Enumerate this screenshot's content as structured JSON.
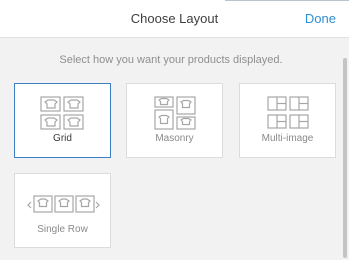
{
  "header": {
    "title": "Choose Layout",
    "done_label": "Done"
  },
  "instruction": "Select how you want your products displayed.",
  "layouts": [
    {
      "label": "Grid",
      "icon": "grid-layout-icon",
      "selected": true
    },
    {
      "label": "Masonry",
      "icon": "masonry-layout-icon",
      "selected": false
    },
    {
      "label": "Multi-image",
      "icon": "multi-image-layout-icon",
      "selected": false
    },
    {
      "label": "Single Row",
      "icon": "single-row-layout-icon",
      "selected": false
    }
  ],
  "colors": {
    "accent": "#2f8fd6",
    "selected_border": "#3c7fc4",
    "icon_gray": "#a6a6a6"
  }
}
